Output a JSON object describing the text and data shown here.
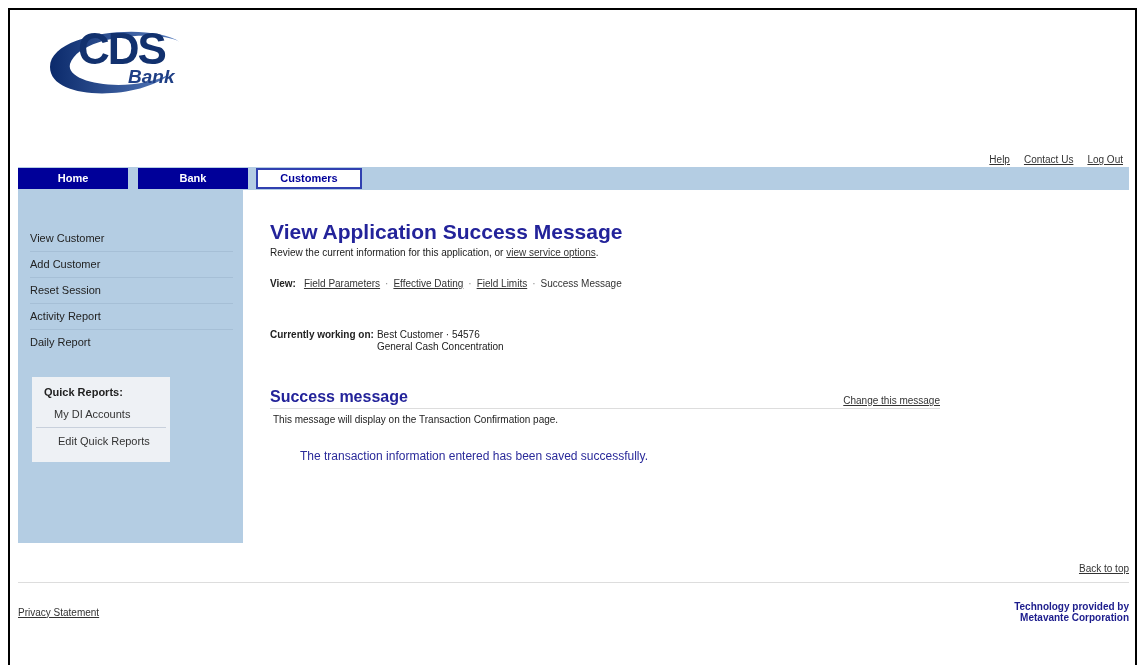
{
  "logo": {
    "name": "CDS",
    "sub": "Bank"
  },
  "top_links": [
    "Help",
    "Contact Us",
    "Log Out"
  ],
  "tabs": [
    {
      "label": "Home",
      "selected": false
    },
    {
      "label": "Bank",
      "selected": false
    },
    {
      "label": "Customers",
      "selected": true
    }
  ],
  "sidebar": {
    "items": [
      "View Customer",
      "Add Customer",
      "Reset Session",
      "Activity Report",
      "Daily Report"
    ],
    "quick_reports": {
      "title": "Quick Reports:",
      "items": [
        "My DI Accounts",
        "Edit Quick Reports"
      ]
    }
  },
  "page": {
    "title": "View Application Success Message",
    "intro": "Review the current information for this application, or",
    "intro_link": "view service options",
    "intro_end": ".",
    "view_separator": "·",
    "view_label": "View:",
    "views": [
      {
        "label": "Field Parameters",
        "selected": false
      },
      {
        "label": "Effective Dating",
        "selected": false
      },
      {
        "label": "Field Limits",
        "selected": false
      },
      {
        "label": "Success Message",
        "selected": true
      }
    ],
    "working_label": "Currently working on:",
    "working_lines": [
      "Best Customer · 54576",
      "General Cash Concentration"
    ]
  },
  "section": {
    "title": "Success message",
    "action": "Change this message",
    "note": "This message will display on the Transaction Confirmation page.",
    "message": "The transaction information entered has been saved successfully."
  },
  "footer": {
    "back_to_top": "Back to top",
    "privacy": "Privacy Statement",
    "credit": [
      "Technology provided by",
      "Metavante Corporation"
    ]
  }
}
